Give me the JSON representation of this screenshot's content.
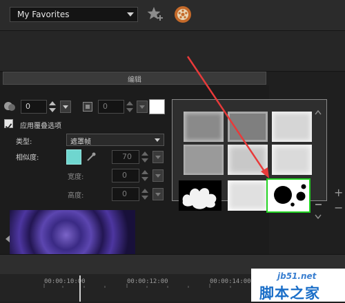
{
  "toolbar": {
    "favorites_value": "My Favorites",
    "icons": [
      "add-favorite-star-icon",
      "gift-icon"
    ]
  },
  "edit_tab": {
    "label": "编辑"
  },
  "overlay": {
    "opacity_value": "0",
    "border_value": "0",
    "border_color": "#ffffff",
    "apply_overlay_checked": true,
    "apply_overlay_label": "应用覆叠选项",
    "type_label": "类型:",
    "type_value": "遮罩帧",
    "similarity_label": "相似度:",
    "similarity_color": "#6fd6cf",
    "similarity_value": "70",
    "width_label": "宽度:",
    "width_value": "0",
    "height_label": "高度:",
    "height_value": "0"
  },
  "mask_picker": {
    "tiles": [
      {
        "name": "mask-soft-square-gray",
        "selected": false
      },
      {
        "name": "mask-frame-gray",
        "selected": false
      },
      {
        "name": "mask-soft-square-light",
        "selected": false
      },
      {
        "name": "mask-plain-gray",
        "selected": false
      },
      {
        "name": "mask-rough-edge-gray",
        "selected": false
      },
      {
        "name": "mask-rough-edge-light",
        "selected": false
      },
      {
        "name": "mask-cloud-splash",
        "selected": false
      },
      {
        "name": "mask-grunge-light",
        "selected": false
      },
      {
        "name": "mask-circles",
        "selected": true
      }
    ],
    "selection_color": "#22d422",
    "annotation_arrow_color": "#e83a3a"
  },
  "side_controls": {
    "plus": "+",
    "minus": "−"
  },
  "timeline": {
    "ticks": [
      "00:00:10:00",
      "00:00:12:00",
      "00:00:14:00"
    ]
  },
  "watermark": {
    "site": "jb51.net",
    "brand": "脚本之家"
  }
}
